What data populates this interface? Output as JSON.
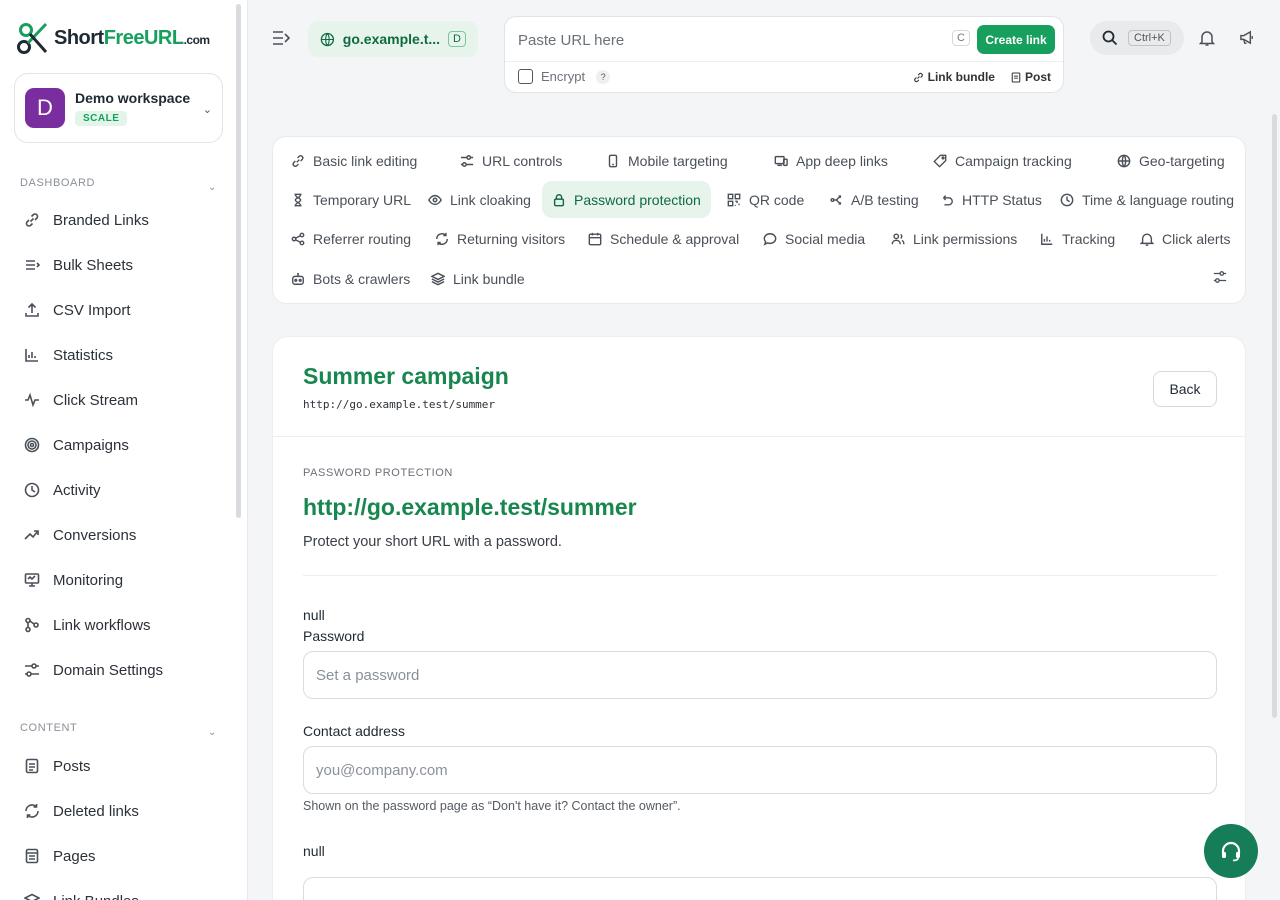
{
  "logo": {
    "part1": "Short",
    "part2": "Free",
    "part3": "URL",
    "part4": ".com"
  },
  "workspace": {
    "initial": "D",
    "name": "Demo workspace",
    "plan": "SCALE"
  },
  "sidebar": {
    "dashboard_label": "DASHBOARD",
    "dashboard_items": [
      {
        "label": "Branded Links",
        "icon": "link-icon"
      },
      {
        "label": "Bulk Sheets",
        "icon": "list-icon"
      },
      {
        "label": "CSV Import",
        "icon": "upload-icon"
      },
      {
        "label": "Statistics",
        "icon": "bar-chart-icon"
      },
      {
        "label": "Click Stream",
        "icon": "pulse-icon"
      },
      {
        "label": "Campaigns",
        "icon": "target-icon"
      },
      {
        "label": "Activity",
        "icon": "clock-icon"
      },
      {
        "label": "Conversions",
        "icon": "trending-icon"
      },
      {
        "label": "Monitoring",
        "icon": "monitor-icon"
      },
      {
        "label": "Link workflows",
        "icon": "workflow-icon"
      },
      {
        "label": "Domain Settings",
        "icon": "sliders-icon"
      }
    ],
    "content_label": "CONTENT",
    "content_items": [
      {
        "label": "Posts",
        "icon": "document-icon"
      },
      {
        "label": "Deleted links",
        "icon": "refresh-icon"
      },
      {
        "label": "Pages",
        "icon": "pages-icon"
      },
      {
        "label": "Link Bundles",
        "icon": "layers-icon"
      }
    ]
  },
  "topbar": {
    "domain": "go.example.t...",
    "domain_badge": "D",
    "url_placeholder": "Paste URL here",
    "shortcut_key": "C",
    "create_label": "Create link",
    "encrypt_label": "Encrypt",
    "help_mark": "?",
    "link_bundle_label": "Link bundle",
    "post_label": "Post",
    "search_shortcut": "Ctrl+K"
  },
  "tabs": [
    {
      "label": "Basic link editing",
      "icon": "link-icon"
    },
    {
      "label": "URL controls",
      "icon": "sliders-icon"
    },
    {
      "label": "Mobile targeting",
      "icon": "phone-icon"
    },
    {
      "label": "App deep links",
      "icon": "devices-icon"
    },
    {
      "label": "Campaign tracking",
      "icon": "tag-icon"
    },
    {
      "label": "Geo-targeting",
      "icon": "globe-icon"
    },
    {
      "label": "Temporary URL",
      "icon": "hourglass-icon"
    },
    {
      "label": "Link cloaking",
      "icon": "eye-icon"
    },
    {
      "label": "Password protection",
      "icon": "lock-icon",
      "active": true
    },
    {
      "label": "QR code",
      "icon": "qr-icon"
    },
    {
      "label": "A/B testing",
      "icon": "split-icon"
    },
    {
      "label": "HTTP Status",
      "icon": "undo-icon"
    },
    {
      "label": "Time & language routing",
      "icon": "clock-icon"
    },
    {
      "label": "Referrer routing",
      "icon": "share-icon"
    },
    {
      "label": "Returning visitors",
      "icon": "refresh-icon"
    },
    {
      "label": "Schedule & approval",
      "icon": "calendar-icon"
    },
    {
      "label": "Social media",
      "icon": "chat-icon"
    },
    {
      "label": "Link permissions",
      "icon": "users-icon"
    },
    {
      "label": "Tracking",
      "icon": "bar-chart-icon"
    },
    {
      "label": "Click alerts",
      "icon": "bell-icon"
    },
    {
      "label": "Bots & crawlers",
      "icon": "bot-icon"
    },
    {
      "label": "Link bundle",
      "icon": "layers-icon"
    }
  ],
  "card": {
    "title": "Summer campaign",
    "url": "http://go.example.test/summer",
    "back_label": "Back",
    "section_label": "PASSWORD PROTECTION",
    "big_url": "http://go.example.test/summer",
    "description": "Protect your short URL with a password.",
    "null_label_1": "null",
    "password_label": "Password",
    "password_placeholder": "Set a password",
    "contact_label": "Contact address",
    "contact_placeholder": "you@company.com",
    "contact_hint": "Shown on the password page as “Don't have it? Contact the owner”.",
    "null_label_2": "null"
  }
}
